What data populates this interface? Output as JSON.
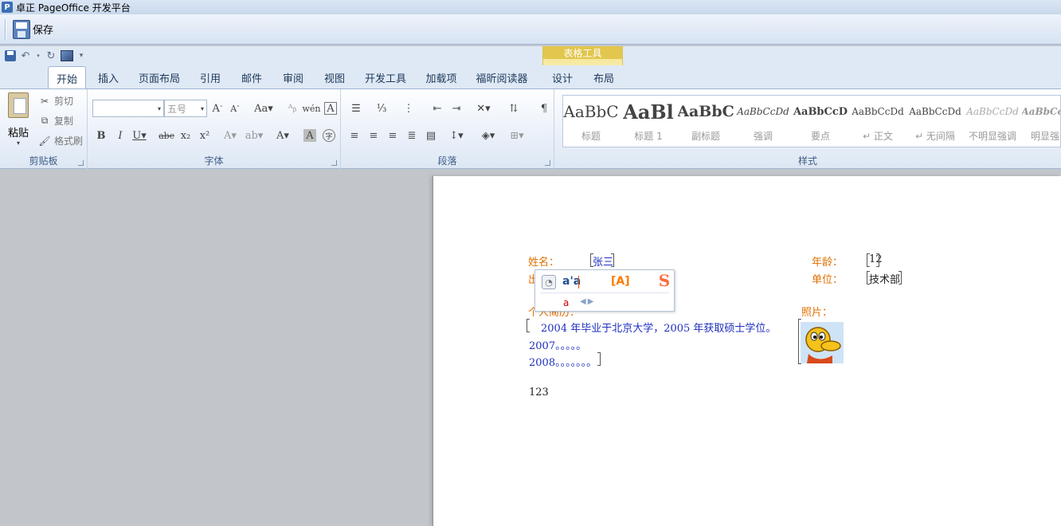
{
  "window": {
    "title": "卓正 PageOffice 开发平台",
    "app_icon": "P"
  },
  "po_toolbar": {
    "save_label": "保存"
  },
  "tabs": [
    {
      "label": "开始",
      "active": true
    },
    {
      "label": "插入"
    },
    {
      "label": "页面布局"
    },
    {
      "label": "引用"
    },
    {
      "label": "邮件"
    },
    {
      "label": "审阅"
    },
    {
      "label": "视图"
    },
    {
      "label": "开发工具"
    },
    {
      "label": "加载项"
    },
    {
      "label": "福昕阅读器"
    },
    {
      "label": "设计"
    },
    {
      "label": "布局"
    }
  ],
  "context_group_label": "表格工具",
  "clipboard": {
    "group_label": "剪贴板",
    "paste": "粘贴",
    "cut": "剪切",
    "copy": "复制",
    "format_painter": "格式刷"
  },
  "font": {
    "group_label": "字体",
    "font_name": "",
    "font_size": "五号"
  },
  "paragraph": {
    "group_label": "段落"
  },
  "styles": {
    "group_label": "样式",
    "items": [
      {
        "sample": "AaBbC",
        "name": "标题"
      },
      {
        "sample": "AaBl",
        "name": "标题 1"
      },
      {
        "sample": "AaBbC",
        "name": "副标题"
      },
      {
        "sample": "AaBbCcDd",
        "name": "强调"
      },
      {
        "sample": "AaBbCcD",
        "name": "要点"
      },
      {
        "sample": "AaBbCcDd",
        "name": "↵ 正文"
      },
      {
        "sample": "AaBbCcDd",
        "name": "↵ 无间隔"
      },
      {
        "sample": "AaBbCcDd",
        "name": "不明显强调"
      },
      {
        "sample": "AaBbCcDd",
        "name": "明显强调"
      }
    ]
  },
  "document": {
    "name_label": "姓名：",
    "name_value": "张三",
    "age_label": "年龄：",
    "age_value": "12",
    "dept_label": "单位：",
    "dept_value": "技术部",
    "birth_label_partial": "出",
    "resume_label_partial": "个人简历：",
    "photo_label": "照片：",
    "resume_line1": "2004 年毕业于北京大学，2005 年获取硕士学位。",
    "resume_line2": "2007。。。。。",
    "resume_line3": "2008。。。。。。。",
    "footer_text": "123"
  },
  "ime": {
    "input": "a'a",
    "option": "[A]",
    "candidate": "a",
    "logo": "S"
  }
}
